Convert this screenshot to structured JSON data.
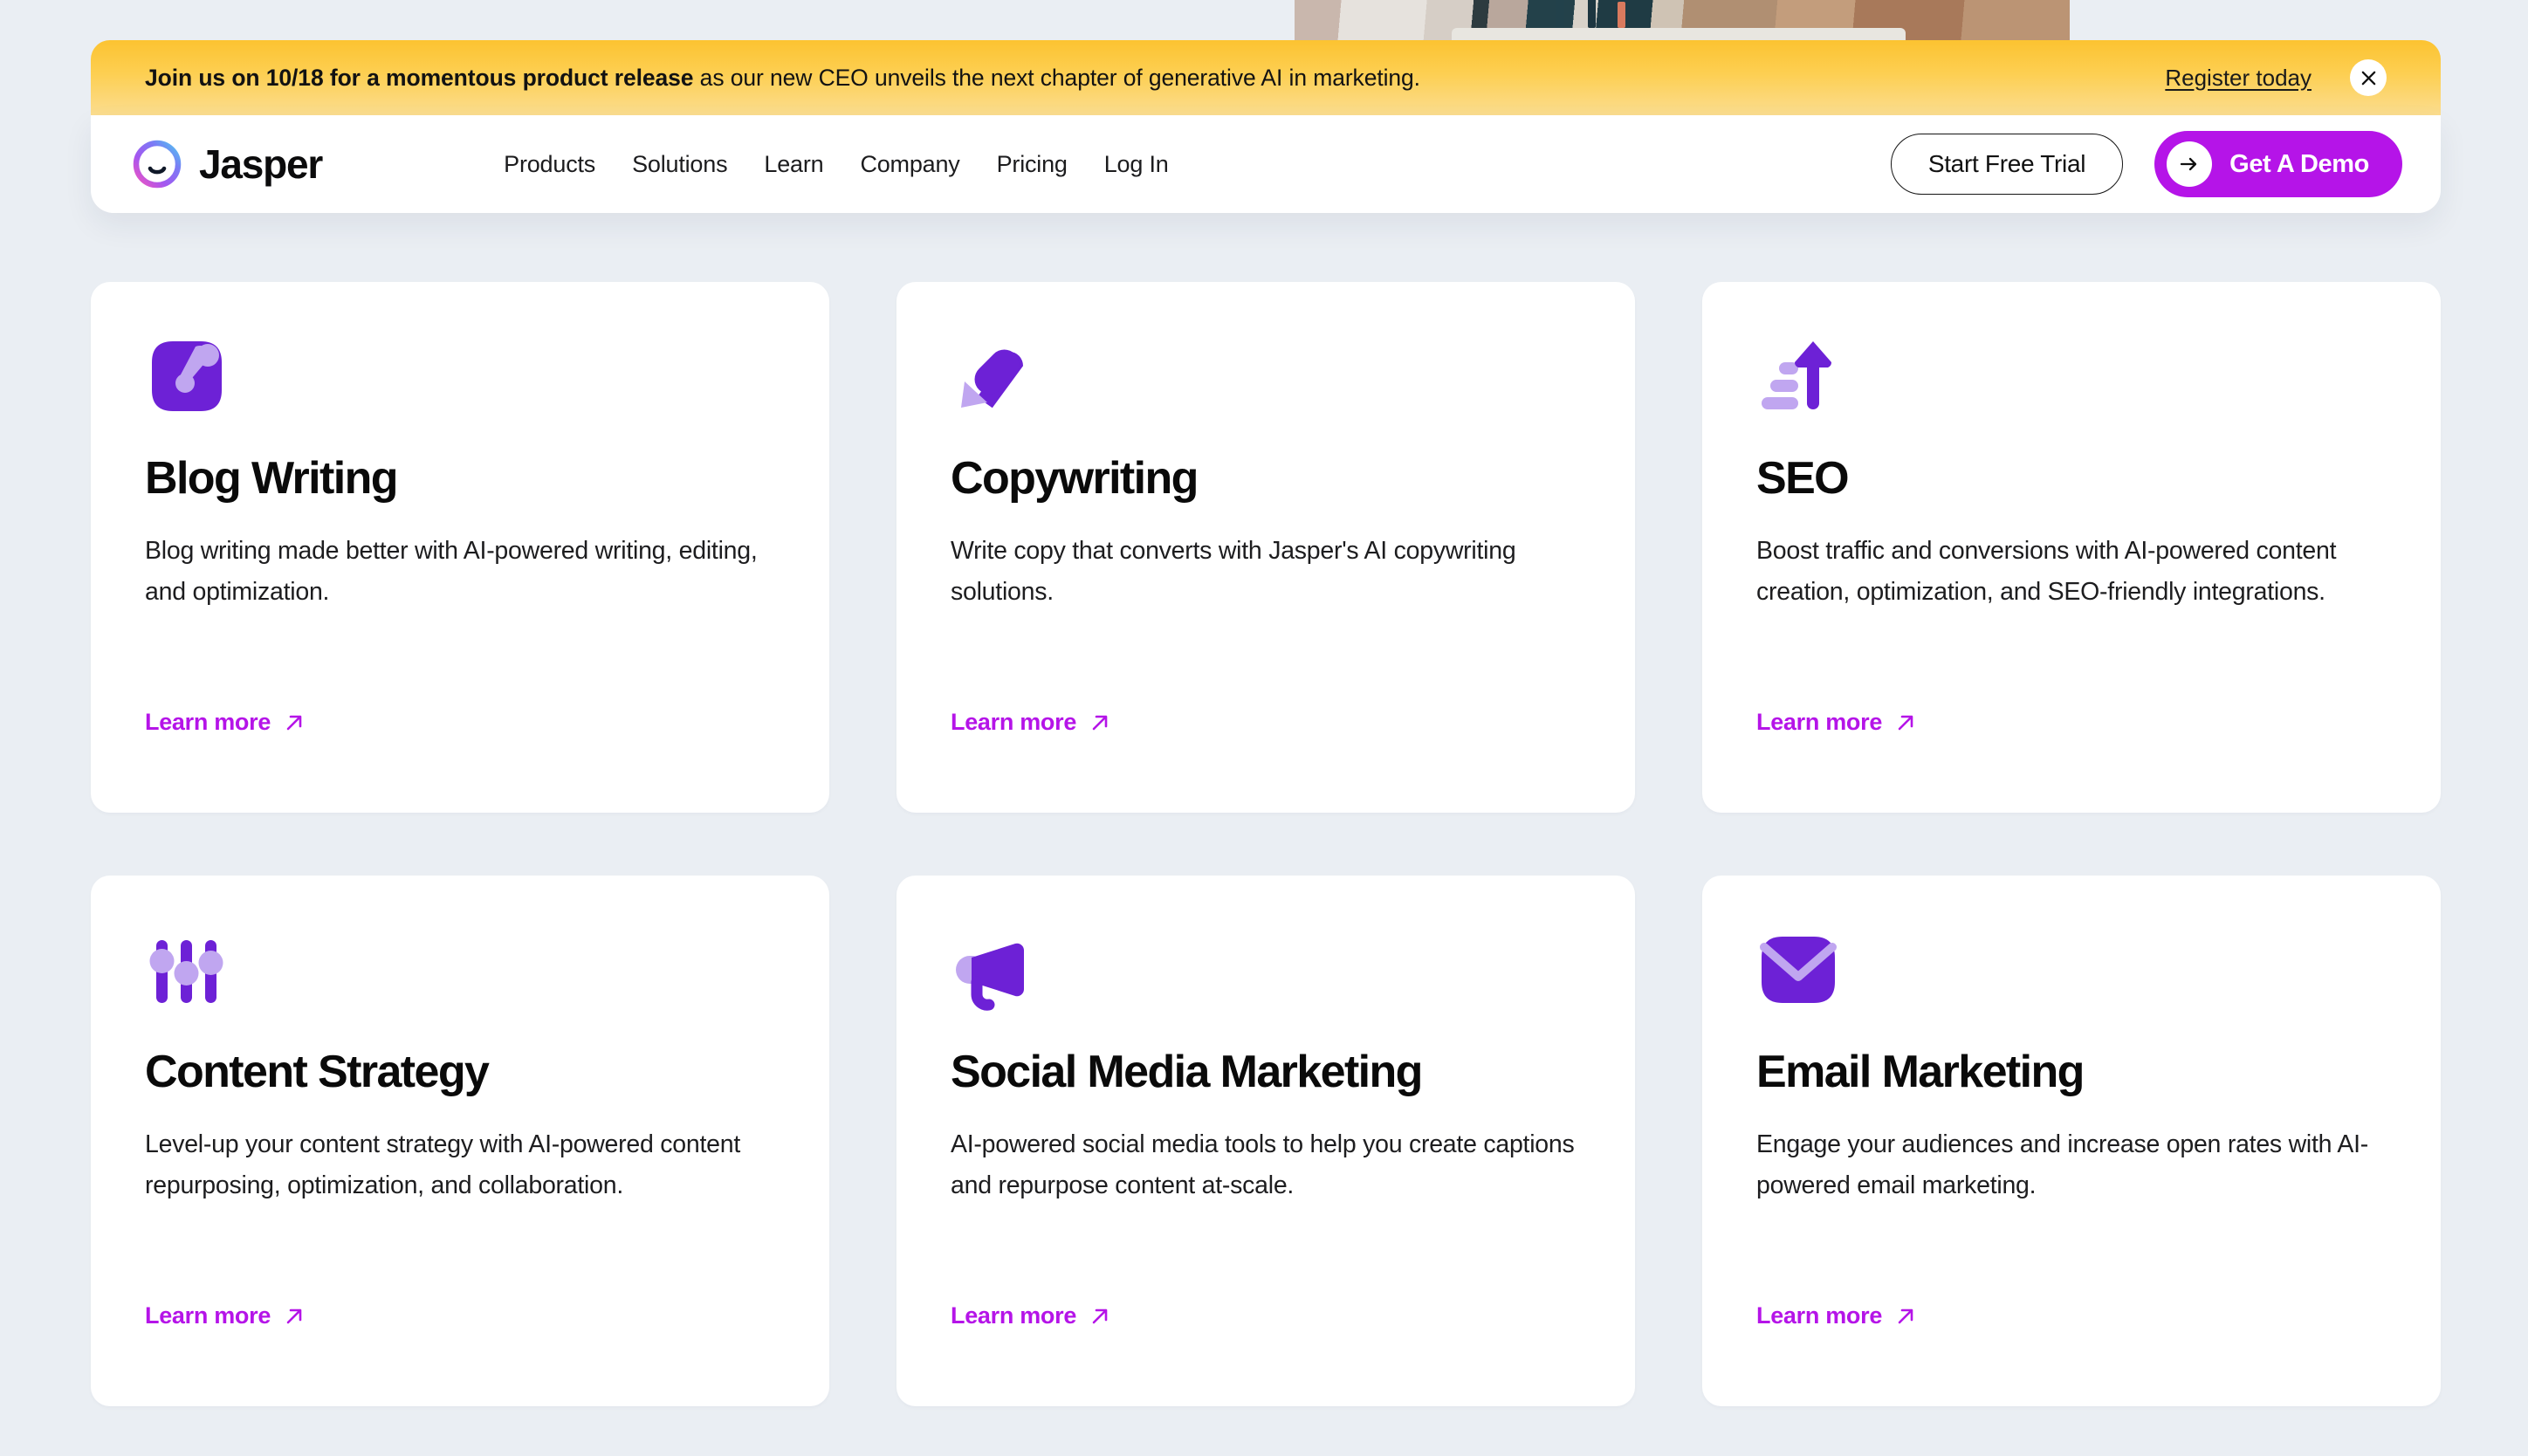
{
  "banner": {
    "bold_text": "Join us on 10/18 for a momentous product release",
    "rest_text": " as our new CEO unveils the next chapter of generative AI in marketing.",
    "register_label": "Register today",
    "close_icon": "close-icon",
    "background_color": "#fcc331"
  },
  "header": {
    "brand_name": "Jasper",
    "brand_icon": "jasper-logo-icon",
    "nav": [
      {
        "label": "Products"
      },
      {
        "label": "Solutions"
      },
      {
        "label": "Learn"
      },
      {
        "label": "Company"
      },
      {
        "label": "Pricing"
      },
      {
        "label": "Log In"
      }
    ],
    "start_free_trial_label": "Start Free Trial",
    "get_a_demo_label": "Get A Demo",
    "demo_arrow_icon": "arrow-right-icon",
    "accent_color": "#b514e8"
  },
  "cards": [
    {
      "icon": "blog-writing-icon",
      "title": "Blog Writing",
      "description": "Blog writing made better with AI-powered writing, editing, and optimization.",
      "link_label": "Learn more",
      "link_icon": "arrow-up-right-icon"
    },
    {
      "icon": "copywriting-pen-icon",
      "title": "Copywriting",
      "description": "Write copy that converts with Jasper's AI copywriting solutions.",
      "link_label": "Learn more",
      "link_icon": "arrow-up-right-icon"
    },
    {
      "icon": "seo-growth-arrow-icon",
      "title": "SEO",
      "description": "Boost traffic and conversions with AI-powered content creation, optimization, and SEO-friendly integrations.",
      "link_label": "Learn more",
      "link_icon": "arrow-up-right-icon"
    },
    {
      "icon": "content-strategy-sliders-icon",
      "title": "Content Strategy",
      "description": "Level-up your content strategy with AI-powered content repurposing, optimization, and collaboration.",
      "link_label": "Learn more",
      "link_icon": "arrow-up-right-icon"
    },
    {
      "icon": "social-media-megaphone-icon",
      "title": "Social Media Marketing",
      "description": "AI-powered social media tools to help you create captions and repurpose content at-scale.",
      "link_label": "Learn more",
      "link_icon": "arrow-up-right-icon"
    },
    {
      "icon": "email-marketing-envelope-icon",
      "title": "Email Marketing",
      "description": "Engage your audiences and increase open rates with AI-powered email marketing.",
      "link_label": "Learn more",
      "link_icon": "arrow-up-right-icon"
    }
  ],
  "theme": {
    "page_background": "#eaeef3",
    "card_background": "#ffffff",
    "icon_dark_purple": "#6d21d6",
    "icon_light_purple": "#c0a6f0"
  }
}
